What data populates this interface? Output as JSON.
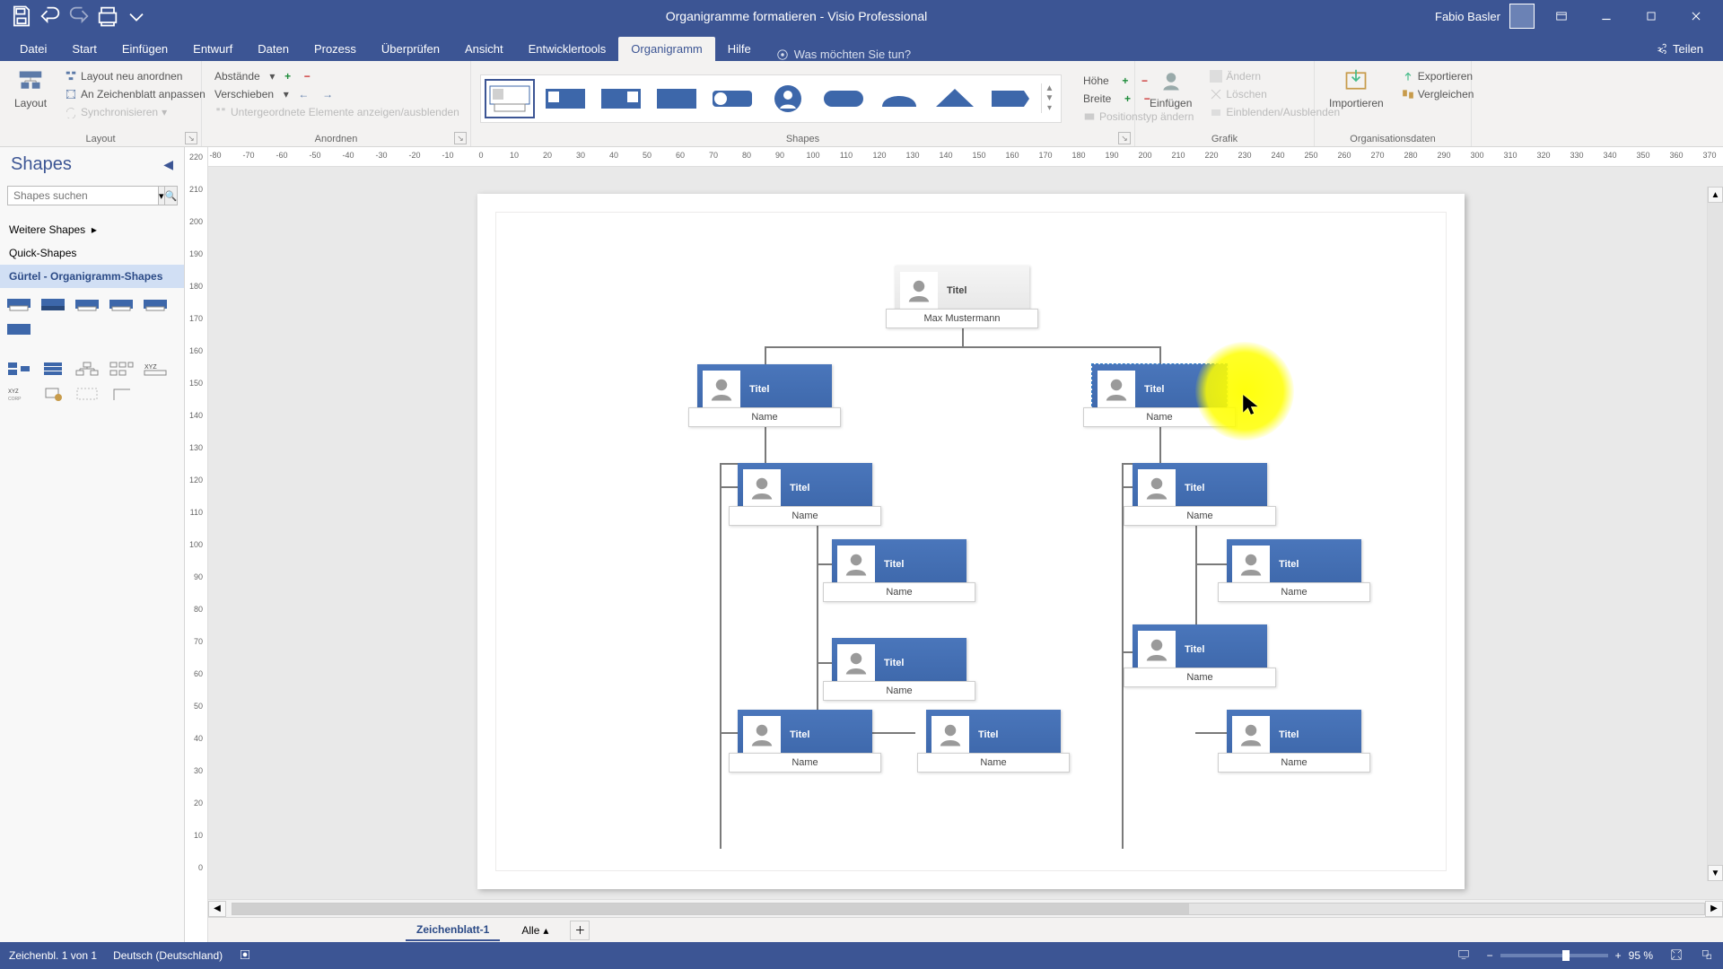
{
  "app": {
    "title": "Organigramme formatieren  -  Visio Professional",
    "user": "Fabio Basler"
  },
  "tabs": {
    "items": [
      "Datei",
      "Start",
      "Einfügen",
      "Entwurf",
      "Daten",
      "Prozess",
      "Überprüfen",
      "Ansicht",
      "Entwicklertools",
      "Organigramm",
      "Hilfe"
    ],
    "active": 9,
    "tell_me": "Was möchten Sie tun?",
    "share": "Teilen"
  },
  "ribbon": {
    "layout_big": "Layout",
    "layout_neu": "Layout neu anordnen",
    "zeichenblatt": "An Zeichenblatt anpassen",
    "synchro": "Synchronisieren",
    "grp_layout": "Layout",
    "abstande": "Abstände",
    "verschieben": "Verschieben",
    "untergeordnete": "Untergeordnete Elemente anzeigen/ausblenden",
    "grp_anordnen": "Anordnen",
    "hoehe": "Höhe",
    "breite": "Breite",
    "positionstyp": "Positionstyp ändern",
    "grp_shapes": "Shapes",
    "einfuegen": "Einfügen",
    "aendern": "Ändern",
    "loeschen": "Löschen",
    "einaus": "Einblenden/Ausblenden",
    "grp_grafik": "Grafik",
    "importieren": "Importieren",
    "exportieren": "Exportieren",
    "vergleichen": "Vergleichen",
    "grp_orgdaten": "Organisationsdaten"
  },
  "shapes_pane": {
    "title": "Shapes",
    "search_placeholder": "Shapes suchen",
    "more_shapes": "Weitere Shapes",
    "quick": "Quick-Shapes",
    "stencil": "Gürtel - Organigramm-Shapes"
  },
  "hruler": [
    -80,
    -70,
    -60,
    -50,
    -40,
    -30,
    -20,
    -10,
    0,
    10,
    20,
    30,
    40,
    50,
    60,
    70,
    80,
    90,
    100,
    110,
    120,
    130,
    140,
    150,
    160,
    170,
    180,
    190,
    200,
    210,
    220,
    230,
    240,
    250,
    260,
    270,
    280,
    290,
    300,
    310,
    320,
    330,
    340,
    350,
    360,
    370
  ],
  "vruler": [
    220,
    210,
    200,
    190,
    180,
    170,
    160,
    150,
    140,
    130,
    120,
    110,
    100,
    90,
    80,
    70,
    60,
    50,
    40,
    30,
    20,
    10,
    0
  ],
  "org": {
    "titel": "Titel",
    "name": "Name",
    "top_name": "Max Mustermann"
  },
  "sheet": {
    "tab": "Zeichenblatt-1",
    "alle": "Alle"
  },
  "status": {
    "info1": "Zeichenbl. 1 von 1",
    "lang": "Deutsch (Deutschland)",
    "zoom": "95 %"
  }
}
